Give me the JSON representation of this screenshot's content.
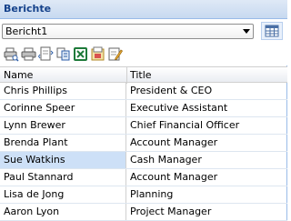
{
  "panel": {
    "title": "Berichte"
  },
  "report_select": {
    "value": "Bericht1"
  },
  "toolbar": {
    "icons": [
      "print-preview-icon",
      "print-icon",
      "page-setup-icon",
      "copy-icon",
      "excel-export-icon",
      "pdf-export-icon",
      "edit-report-icon"
    ]
  },
  "grid": {
    "columns": [
      "Name",
      "Title"
    ],
    "rows": [
      {
        "name": "Chris Phillips",
        "title": "President & CEO"
      },
      {
        "name": "Corinne Speer",
        "title": "Executive Assistant"
      },
      {
        "name": "Lynn Brewer",
        "title": "Chief Financial Officer"
      },
      {
        "name": "Brenda Plant",
        "title": "Account Manager"
      },
      {
        "name": "Sue Watkins",
        "title": "Cash Manager",
        "selected": true
      },
      {
        "name": "Paul Stannard",
        "title": "Account Manager"
      },
      {
        "name": "Lisa de Jong",
        "title": "Planning"
      },
      {
        "name": "Aaron Lyon",
        "title": "Project Manager"
      }
    ]
  },
  "colors": {
    "header_text": "#15428b",
    "header_bg": "#dfe9f6",
    "selection": "#cde0f7",
    "border": "#99bbe8"
  }
}
